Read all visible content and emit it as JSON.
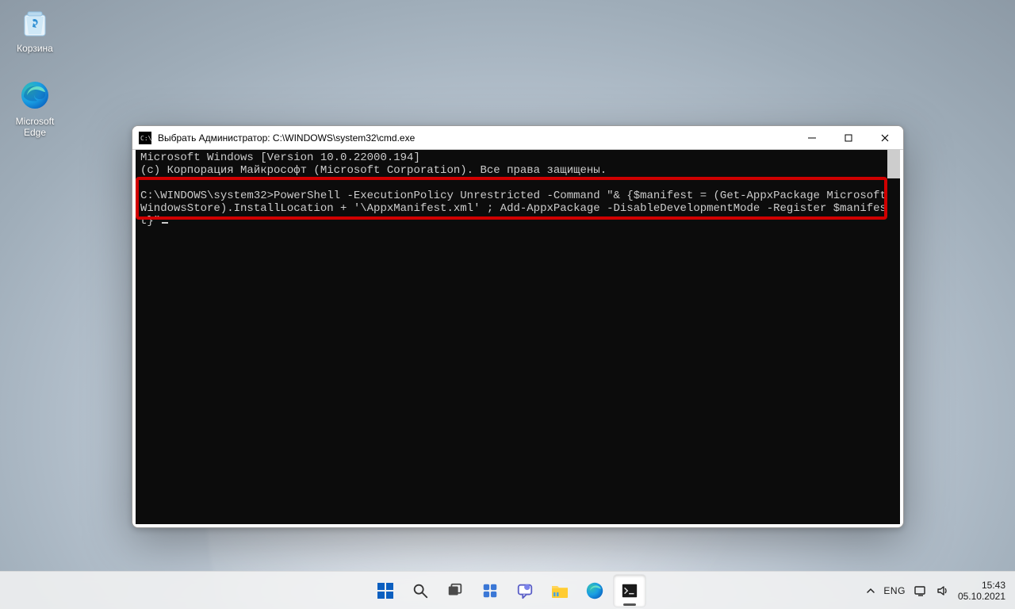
{
  "desktop": {
    "recycle_label": "Корзина",
    "edge_label": "Microsoft Edge"
  },
  "window": {
    "title": "Выбрать Администратор: C:\\WINDOWS\\system32\\cmd.exe"
  },
  "terminal": {
    "line1": "Microsoft Windows [Version 10.0.22000.194]",
    "line2": "(c) Корпорация Майкрософт (Microsoft Corporation). Все права защищены.",
    "prompt": "C:\\WINDOWS\\system32>",
    "command": "PowerShell -ExecutionPolicy Unrestricted -Command \"& {$manifest = (Get-AppxPackage Microsoft.WindowsStore).InstallLocation + '\\AppxManifest.xml' ; Add-AppxPackage -DisableDevelopmentMode -Register $manifest}\""
  },
  "tray": {
    "lang": "ENG",
    "time": "15:43",
    "date": "05.10.2021"
  }
}
